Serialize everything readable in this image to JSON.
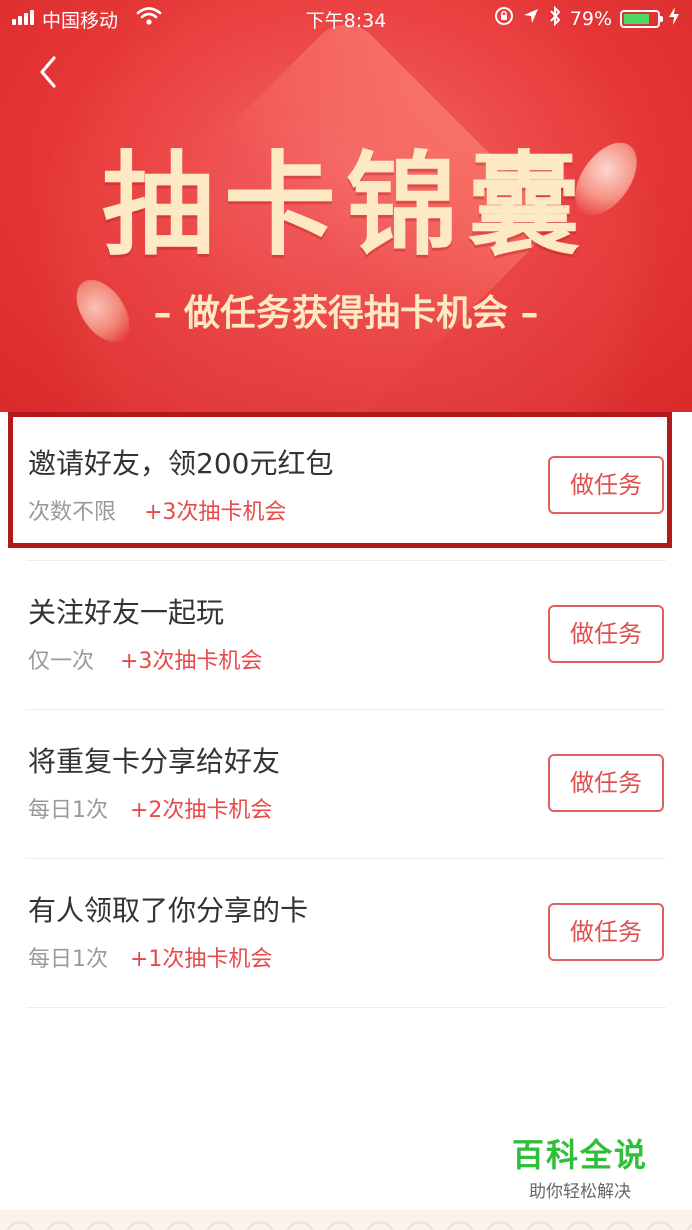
{
  "status_bar": {
    "carrier": "中国移动",
    "time": "下午8:34",
    "battery": "79%",
    "battery_level": 0.79,
    "battery_color": "#4cd964"
  },
  "header": {
    "back_icon": "chevron-left-icon",
    "title": "抽卡锦囊",
    "subtitle": "– 做任务获得抽卡机会 –"
  },
  "colors": {
    "banner_red": "#e63c3c",
    "title_cream": "#fde9c4",
    "reward_red": "#e84a4a",
    "highlight_border": "#b01a1a"
  },
  "tasks": [
    {
      "title": "邀请好友，领200元红包",
      "frequency": "次数不限",
      "reward": "+3次抽卡机会",
      "button": "做任务",
      "highlighted": true
    },
    {
      "title": "关注好友一起玩",
      "frequency": "仅一次",
      "reward": "+3次抽卡机会",
      "button": "做任务",
      "highlighted": false
    },
    {
      "title": "将重复卡分享给好友",
      "frequency": "每日1次",
      "reward": "+2次抽卡机会",
      "button": "做任务",
      "highlighted": false
    },
    {
      "title": "有人领取了你分享的卡",
      "frequency": "每日1次",
      "reward": "+1次抽卡机会",
      "button": "做任务",
      "highlighted": false
    }
  ],
  "watermark": {
    "title": "百科全说",
    "subtitle": "助你轻松解决"
  }
}
